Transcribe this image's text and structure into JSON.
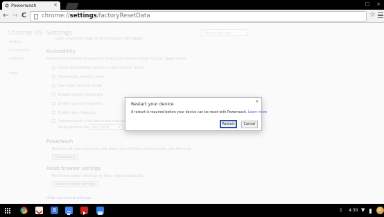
{
  "window": {
    "tab_title": "Powerwash",
    "tab_close": "×",
    "controls": [
      "□",
      "×"
    ]
  },
  "toolbar": {
    "back": "←",
    "forward": "→",
    "reload": "C",
    "url_scheme": "chrome://",
    "url_host": "settings",
    "url_path": "/factoryResetData",
    "star": "☆"
  },
  "sidebar": {
    "title": "Chrome OS",
    "items": [
      "History",
      "Extensions",
      "Settings",
      "",
      "Help"
    ]
  },
  "settings": {
    "title": "Settings",
    "search_placeholder": "Search settings",
    "startup_option": "Open a specific page or set of pages.",
    "startup_link": "Set pages",
    "accessibility": {
      "heading": "Accessibility",
      "desc": "Enable accessibility features to make your device easier to use.",
      "desc_link": "Learn more",
      "options": [
        "Show accessibility options in the system menu",
        "Show large mouse cursor",
        "Use high contrast mode",
        "Enable spoken feedback",
        "Enable screen magnifier",
        "Enable tap dragging",
        "Automatically click when the mouse pointer stops"
      ],
      "delay_label": "Delay before click:",
      "delay_value": "very short"
    },
    "powerwash": {
      "heading": "Powerwash",
      "desc": "Remove all user accounts and reset your Chrome device to be just like new.",
      "button": "Powerwash"
    },
    "reset": {
      "heading": "Reset browser settings",
      "desc": "Restore browser settings to their original defaults.",
      "button": "Reset browser settings"
    },
    "advanced_link": "Hide advanced settings..."
  },
  "dialog": {
    "title": "Restart your device",
    "close": "×",
    "message": "A restart is required before your device can be reset with Powerwash.",
    "link": "Learn more",
    "restart_button": "Restart",
    "cancel_button": "Cancel"
  },
  "shelf": {
    "apps": [
      "chrome",
      "gmail",
      "google-plus",
      "docs",
      "youtube",
      "files"
    ],
    "notification_count": "1",
    "time": "4:30",
    "colors": {
      "chrome": "#db4437",
      "gmail": "#d93025",
      "google-plus": "#3b6fd8",
      "docs": "#4285f4",
      "youtube": "#cc1f1f",
      "files": "#2b83e6"
    }
  }
}
